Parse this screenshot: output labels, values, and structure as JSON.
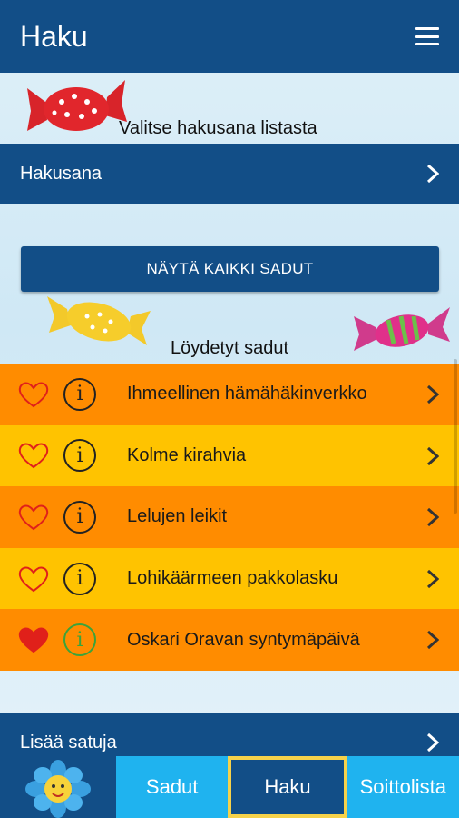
{
  "header": {
    "title": "Haku",
    "menu_icon": "hamburger-menu-icon"
  },
  "hint": {
    "text": "Valitse hakusana listasta"
  },
  "search_term": {
    "label": "Hakusana"
  },
  "show_all": {
    "label": "NÄYTÄ KAIKKI SADUT"
  },
  "found": {
    "label": "Löydetyt sadut"
  },
  "stories": [
    {
      "title": "Ihmeellinen hämähäkinverkko",
      "favorite": false,
      "color": "#ff8c00"
    },
    {
      "title": "Kolme kirahvia",
      "favorite": false,
      "color": "#ffc300"
    },
    {
      "title": "Lelujen leikit",
      "favorite": false,
      "color": "#ff8c00"
    },
    {
      "title": "Lohikäärmeen pakkolasku",
      "favorite": false,
      "color": "#ffc300"
    },
    {
      "title": "Oskari Oravan syntymäpäivä",
      "favorite": true,
      "color": "#ff8c00"
    }
  ],
  "more": {
    "label": "Lisää satuja"
  },
  "tabs": [
    {
      "label": "Sadut",
      "active": false
    },
    {
      "label": "Haku",
      "active": true
    },
    {
      "label": "Soittolista",
      "active": false
    }
  ],
  "colors": {
    "primary": "#124e87",
    "tab_blue": "#1fb3ef",
    "active_border": "#f6d24a",
    "orange": "#ff8c00",
    "yellow": "#ffc300",
    "heart_red": "#e0201a",
    "info_green": "#3ba33b"
  }
}
